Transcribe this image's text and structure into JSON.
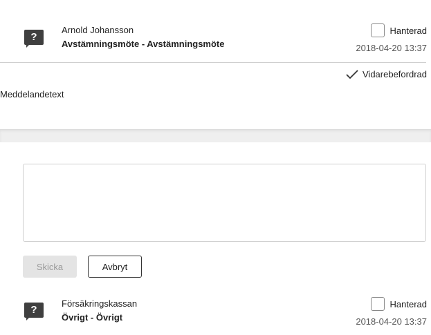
{
  "messages": [
    {
      "icon": "question-icon",
      "icon_glyph": "?",
      "sender": "Arnold Johansson",
      "subject": "Avstämningsmöte - Avstämningsmöte",
      "handled_label": "Hanterad",
      "handled_checked": false,
      "date": "2018-04-20 13:37",
      "forwarded_label": "Vidarebefordrad",
      "body": "Meddelandetext"
    },
    {
      "icon": "question-icon",
      "icon_glyph": "?",
      "sender": "Försäkringskassan",
      "subject": "Övrigt - Övrigt",
      "handled_label": "Hanterad",
      "handled_checked": false,
      "date": "2018-04-20 13:37"
    }
  ],
  "reply": {
    "value": "",
    "send_label": "Skicka",
    "cancel_label": "Avbryt"
  }
}
